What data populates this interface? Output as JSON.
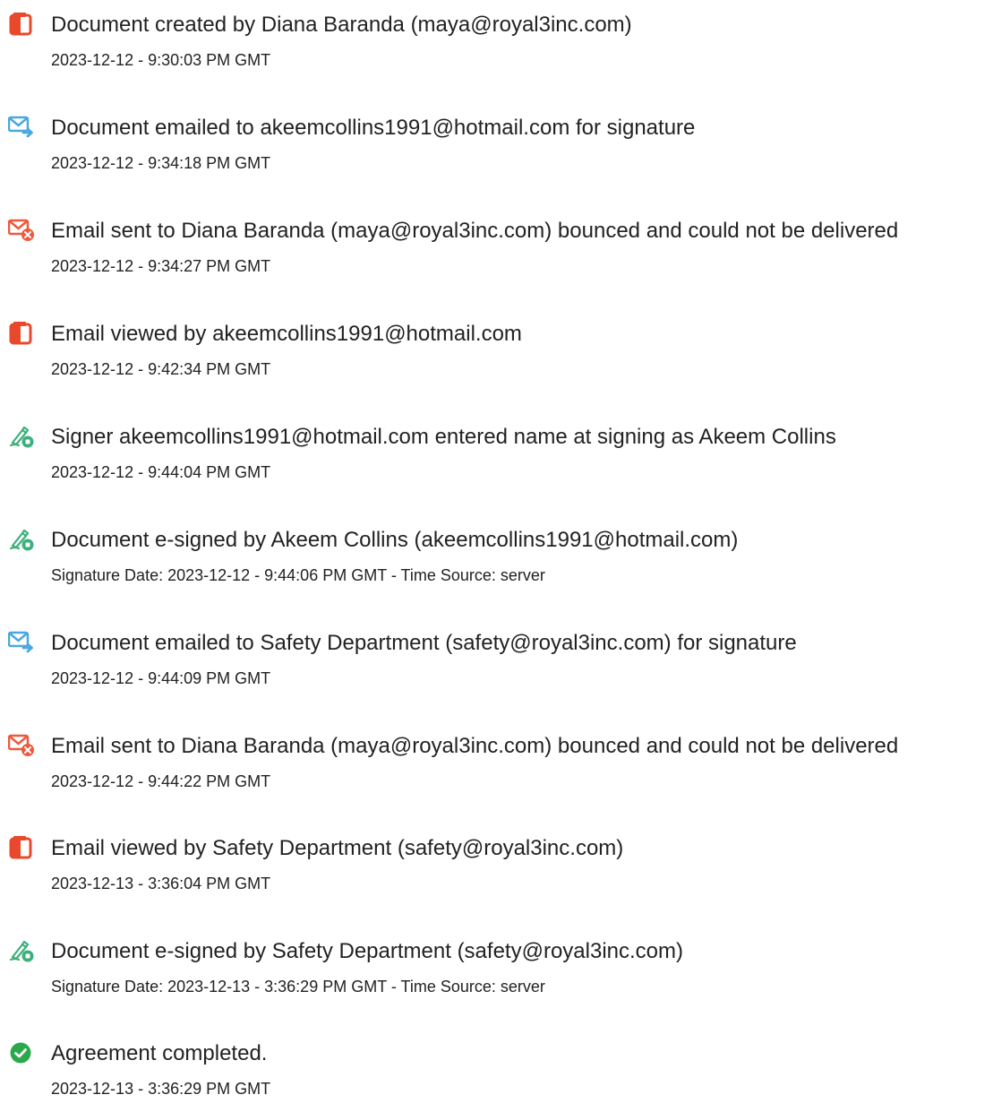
{
  "colors": {
    "doc_red": "#e8492d",
    "mail_blue": "#4aa8df",
    "bounce_red": "#ee5a3c",
    "sign_green": "#3cb07a",
    "complete_green": "#2aa84a"
  },
  "events": [
    {
      "icon": "document-icon",
      "title": "Document created by Diana Baranda (maya@royal3inc.com)",
      "time": "2023-12-12 - 9:30:03 PM GMT"
    },
    {
      "icon": "email-sent-icon",
      "title": "Document emailed to akeemcollins1991@hotmail.com for signature",
      "time": "2023-12-12 - 9:34:18 PM GMT"
    },
    {
      "icon": "email-bounced-icon",
      "title": "Email sent to Diana Baranda (maya@royal3inc.com) bounced and could not be delivered",
      "time": "2023-12-12 - 9:34:27 PM GMT"
    },
    {
      "icon": "document-icon",
      "title": "Email viewed by akeemcollins1991@hotmail.com",
      "time": "2023-12-12 - 9:42:34 PM GMT"
    },
    {
      "icon": "pen-sign-icon",
      "title": "Signer akeemcollins1991@hotmail.com entered name at signing as Akeem Collins",
      "time": "2023-12-12 - 9:44:04 PM GMT"
    },
    {
      "icon": "pen-sign-icon",
      "title": "Document e-signed by Akeem Collins (akeemcollins1991@hotmail.com)",
      "time": "Signature Date: 2023-12-12 - 9:44:06 PM GMT - Time Source: server"
    },
    {
      "icon": "email-sent-icon",
      "title": "Document emailed to Safety Department (safety@royal3inc.com) for signature",
      "time": "2023-12-12 - 9:44:09 PM GMT"
    },
    {
      "icon": "email-bounced-icon",
      "title": "Email sent to Diana Baranda (maya@royal3inc.com) bounced and could not be delivered",
      "time": "2023-12-12 - 9:44:22 PM GMT"
    },
    {
      "icon": "document-icon",
      "title": "Email viewed by Safety Department (safety@royal3inc.com)",
      "time": "2023-12-13 - 3:36:04 PM GMT"
    },
    {
      "icon": "pen-sign-icon",
      "title": "Document e-signed by Safety Department (safety@royal3inc.com)",
      "time": "Signature Date: 2023-12-13 - 3:36:29 PM GMT - Time Source: server"
    },
    {
      "icon": "check-circle-icon",
      "title": "Agreement completed.",
      "time": "2023-12-13 - 3:36:29 PM GMT"
    }
  ]
}
